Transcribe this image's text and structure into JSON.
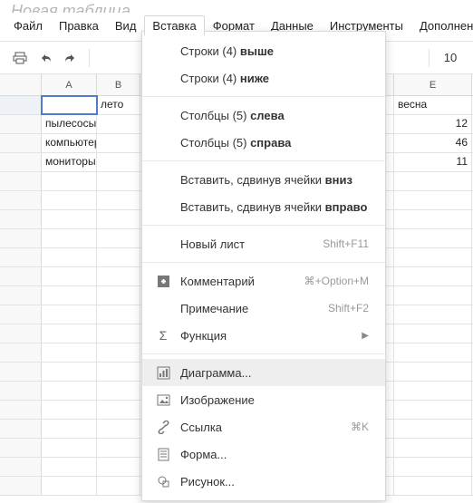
{
  "doc_title": "Новая таблица",
  "menubar": {
    "file": "Файл",
    "edit": "Правка",
    "view": "Вид",
    "insert": "Вставка",
    "format": "Формат",
    "data": "Данные",
    "tools": "Инструменты",
    "addons": "Дополнения"
  },
  "toolbar": {
    "font_size": "10"
  },
  "columns": {
    "a": "A",
    "b": "B",
    "e": "E"
  },
  "cells": {
    "b1": "лето",
    "e1": "весна",
    "a2": "пылесосы",
    "e2": "12",
    "a3": "компьютеры",
    "e3": "46",
    "a4": "мониторы",
    "e4": "11"
  },
  "dropdown": {
    "rows_above_prefix": "Строки (4) ",
    "rows_above_bold": "выше",
    "rows_below_prefix": "Строки (4) ",
    "rows_below_bold": "ниже",
    "cols_left_prefix": "Столбцы (5) ",
    "cols_left_bold": "слева",
    "cols_right_prefix": "Столбцы (5) ",
    "cols_right_bold": "справа",
    "shift_down_prefix": "Вставить, сдвинув ячейки ",
    "shift_down_bold": "вниз",
    "shift_right_prefix": "Вставить, сдвинув ячейки ",
    "shift_right_bold": "вправо",
    "new_sheet": "Новый лист",
    "new_sheet_shortcut": "Shift+F11",
    "comment": "Комментарий",
    "comment_shortcut": "⌘+Option+M",
    "note": "Примечание",
    "note_shortcut": "Shift+F2",
    "function": "Функция",
    "chart": "Диаграмма...",
    "image": "Изображение",
    "link": "Ссылка",
    "link_shortcut": "⌘K",
    "form": "Форма...",
    "drawing": "Рисунок..."
  }
}
